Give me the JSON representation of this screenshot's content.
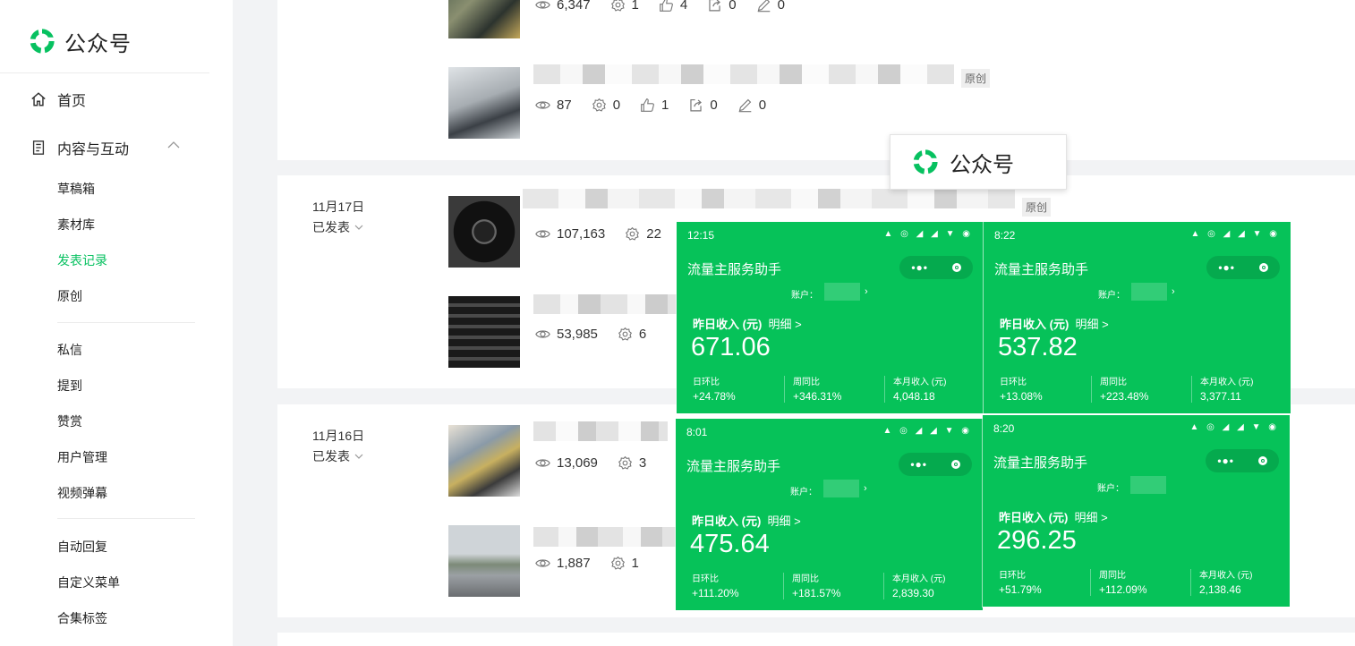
{
  "sidebar": {
    "logo_text": "公众号",
    "home": "首页",
    "content_group": "内容与互动",
    "items": [
      "草稿箱",
      "素材库",
      "发表记录",
      "原创",
      "私信",
      "提到",
      "赞赏",
      "用户管理",
      "视频弹幕",
      "自动回复",
      "自定义菜单",
      "合集标签"
    ],
    "active_item": "发表记录"
  },
  "colors": {
    "brand_green": "#07c160",
    "panel_green": "#06c259"
  },
  "posts": [
    {
      "views": "6,347",
      "shares": "1",
      "likes": "4",
      "forwards": "0",
      "edits": "0"
    },
    {
      "views": "87",
      "shares": "0",
      "likes": "1",
      "forwards": "0",
      "edits": "0",
      "tag": "原创"
    },
    {
      "date": "11月17日",
      "status": "已发表",
      "views": "107,163",
      "shares": "22",
      "tag": "原创"
    },
    {
      "views": "53,985",
      "shares": "6"
    },
    {
      "date": "11月16日",
      "status": "已发表",
      "views": "13,069",
      "shares": "3"
    },
    {
      "views": "1,887",
      "shares": "1"
    }
  ],
  "overlay_logo_text": "公众号",
  "phones": [
    {
      "time": "12:15",
      "title": "流量主服务助手",
      "account_label": "账户：",
      "yesterday_label": "昨日收入 (元)",
      "detail_label": "明细 >",
      "amount": "671.06",
      "m1_label": "日环比",
      "m1": "+24.78%",
      "m2_label": "周同比",
      "m2": "+346.31%",
      "m3_label": "本月收入 (元)",
      "m3": "4,048.18"
    },
    {
      "time": "8:22",
      "title": "流量主服务助手",
      "account_label": "账户：",
      "yesterday_label": "昨日收入 (元)",
      "detail_label": "明细 >",
      "amount": "537.82",
      "m1_label": "日环比",
      "m1": "+13.08%",
      "m2_label": "周同比",
      "m2": "+223.48%",
      "m3_label": "本月收入 (元)",
      "m3": "3,377.11"
    },
    {
      "time": "8:01",
      "title": "流量主服务助手",
      "account_label": "账户：",
      "yesterday_label": "昨日收入 (元)",
      "detail_label": "明细 >",
      "amount": "475.64",
      "m1_label": "日环比",
      "m1": "+111.20%",
      "m2_label": "周同比",
      "m2": "+181.57%",
      "m3_label": "本月收入 (元)",
      "m3": "2,839.30"
    },
    {
      "time": "8:20",
      "title": "流量主服务助手",
      "account_label": "账户：",
      "yesterday_label": "昨日收入 (元)",
      "detail_label": "明细 >",
      "amount": "296.25",
      "m1_label": "日环比",
      "m1": "+51.79%",
      "m2_label": "周同比",
      "m2": "+112.09%",
      "m3_label": "本月收入 (元)",
      "m3": "2,138.46"
    }
  ]
}
